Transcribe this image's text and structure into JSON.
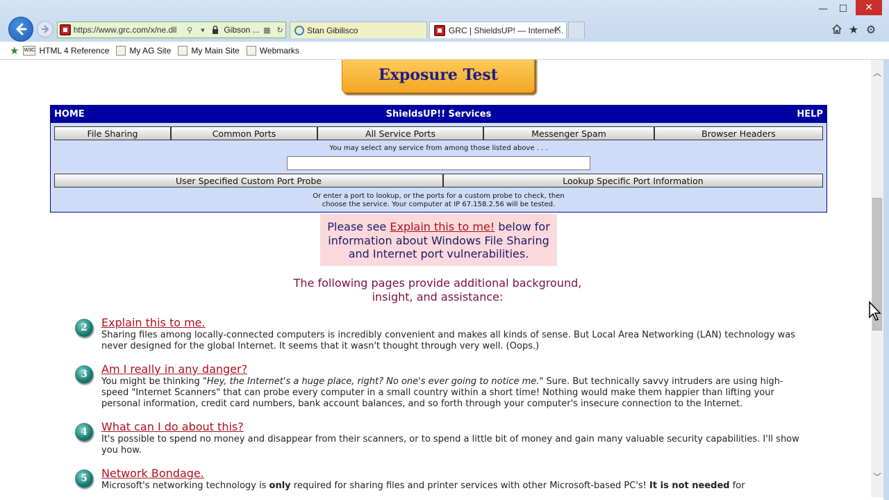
{
  "browser": {
    "address_url": "https://www.grc.com/x/ne.dll",
    "cert_label": "Gibson ...",
    "tabs": [
      {
        "label": "Stan Gibilisco"
      },
      {
        "label": "GRC | ShieldsUP! — Internet..."
      }
    ],
    "window_controls": {
      "minimize": "—",
      "maximize": "☐",
      "close": "✕"
    }
  },
  "favorites": [
    {
      "label": "HTML 4 Reference",
      "icon": "W3C"
    },
    {
      "label": "My AG Site",
      "icon": ""
    },
    {
      "label": "My Main Site",
      "icon": ""
    },
    {
      "label": "Webmarks",
      "icon": ""
    }
  ],
  "page": {
    "exposure_test": "Exposure Test",
    "services": {
      "home": "HOME",
      "title": "ShieldsUP!! Services",
      "help": "HELP",
      "row1": [
        "File Sharing",
        "Common Ports",
        "All Service Ports",
        "Messenger Spam",
        "Browser Headers"
      ],
      "select_note": "You may select any service from among those listed above . . .",
      "port_input_value": "",
      "row2": [
        "User Specified Custom Port Probe",
        "Lookup Specific Port Information"
      ],
      "lookup_note_1": "Or enter a port to lookup, or the ports for a custom probe to check, then",
      "lookup_note_2": "choose the service. Your computer at IP 67.158.2.56 will be tested."
    },
    "pink": {
      "pre": "Please see ",
      "link": "Explain this to me!",
      "post": " below for information about Windows File Sharing and Internet port vulnerabilities."
    },
    "following": "The following pages provide additional background, insight, and assistance:",
    "faq": [
      {
        "num": "2",
        "title": "Explain this to me.",
        "body": "Sharing files among locally-connected computers is incredibly convenient and makes all kinds of sense. But Local Area Networking (LAN) technology was never designed for the global Internet. It seems that it wasn't thought through very well. (Oops.)"
      },
      {
        "num": "3",
        "title": "Am I really in any danger?",
        "body_pre": "You might be thinking ",
        "body_em": "\"Hey, the Internet's a huge place, right? No one's ever going to notice me.\"",
        "body_post": " Sure. But technically savvy intruders are using high-speed \"Internet Scanners\" that can probe every computer in a small country within a short time! Nothing would make them happier than lifting your personal information, credit card numbers, bank account balances, and so forth through your computer's insecure connection to the Internet."
      },
      {
        "num": "4",
        "title": "What can I do about this?",
        "body": "It's possible to spend no money and disappear from their scanners, or to spend a little bit of money and gain many valuable security capabilities. I'll show you how."
      },
      {
        "num": "5",
        "title": "Network Bondage.",
        "body_1": "Microsoft's networking technology is ",
        "body_b1": "only",
        "body_2": " required for sharing files and printer services with other Microsoft-based PC's! ",
        "body_b2": "It is not needed",
        "body_3": " for"
      }
    ]
  }
}
